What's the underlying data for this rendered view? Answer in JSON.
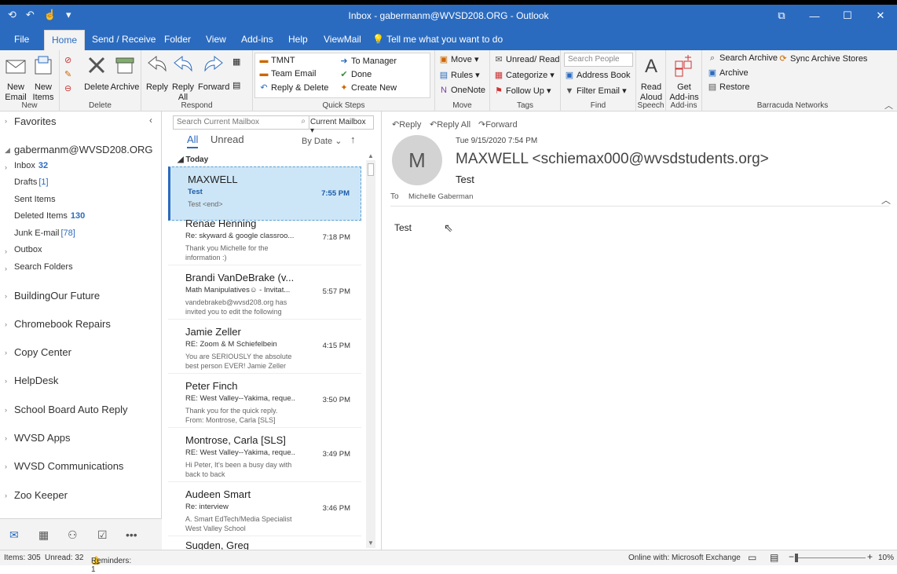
{
  "window": {
    "title": "Inbox - gabermanm@WVSD208.ORG  -  Outlook",
    "qat_icons": [
      "send-receive-icon",
      "undo-icon",
      "touch-mode-icon",
      "customize-icon"
    ],
    "controls": [
      "restore-icon",
      "minimize-icon",
      "maximize-icon",
      "close-icon"
    ]
  },
  "ribbon_tabs": [
    "File",
    "Home",
    "Send / Receive",
    "Folder",
    "View",
    "Add-ins",
    "Help",
    "ViewMail"
  ],
  "tell_me": "Tell me what you want to do",
  "ribbon": {
    "new_email": "New Email",
    "new_items": "New Items",
    "group_new": "New",
    "delete": "Delete",
    "archive": "Archive",
    "group_delete": "Delete",
    "reply": "Reply",
    "reply_all": "Reply All",
    "forward": "Forward",
    "group_respond": "Respond",
    "quick_steps": [
      "TMNT",
      "Team Email",
      "Reply & Delete",
      "To Manager",
      "Done",
      "Create New"
    ],
    "group_quick_steps": "Quick Steps",
    "move": "Move",
    "rules": "Rules",
    "onenote": "OneNote",
    "group_move": "Move",
    "unread_read": "Unread/ Read",
    "categorize": "Categorize",
    "follow_up": "Follow Up",
    "group_tags": "Tags",
    "search_people": "Search People",
    "address_book": "Address Book",
    "filter_email": "Filter Email",
    "group_find": "Find",
    "read_aloud": "Read Aloud",
    "group_speech": "Speech",
    "get_addins": "Get Add-ins",
    "group_addins": "Add-ins",
    "search_archive": "Search Archive",
    "sync_archive": "Sync Archive Stores",
    "archive2": "Archive",
    "restore": "Restore",
    "group_barracuda": "Barracuda Networks"
  },
  "nav": {
    "favorites": "Favorites",
    "account": "gabermanm@WVSD208.ORG",
    "inbox": "Inbox",
    "inbox_count": "32",
    "drafts": "Drafts",
    "drafts_count": "[1]",
    "sent": "Sent Items",
    "deleted": "Deleted Items",
    "deleted_count": "130",
    "junk": "Junk E-mail",
    "junk_count": "[78]",
    "outbox": "Outbox",
    "search_folders": "Search Folders",
    "folders": [
      "BuildingOur Future",
      "Chromebook Repairs",
      "Copy Center",
      "HelpDesk",
      "School Board Auto Reply",
      "WVSD Apps",
      "WVSD Communications",
      "Zoo Keeper"
    ],
    "bottom_icons": [
      "mail-icon",
      "calendar-icon",
      "people-icon",
      "tasks-icon",
      "more-icon"
    ]
  },
  "list": {
    "search_placeholder": "Search Current Mailbox",
    "scope": "Current Mailbox",
    "filter_all": "All",
    "filter_unread": "Unread",
    "sort": "By Date",
    "group_today": "Today",
    "messages": [
      {
        "from": "MAXWELL",
        "subject": "Test",
        "time": "7:55 PM",
        "preview": "Test <end>"
      },
      {
        "from": "Renae Henning",
        "subject": "Re: skyward & google classroo...",
        "time": "7:18 PM",
        "preview": "Thank you Michelle for the information :)"
      },
      {
        "from": "Brandi VanDeBrake (v...",
        "subject": "Math Manipulatives☺ - Invitat...",
        "time": "5:57 PM",
        "preview": "vandebrakeb@wvsd208.org has invited you to edit the following"
      },
      {
        "from": "Jamie Zeller",
        "subject": "RE: Zoom & M Schiefelbein",
        "time": "4:15 PM",
        "preview": "You are SERIOUSLY the absolute best person EVER!  Jamie Zeller"
      },
      {
        "from": "Peter Finch",
        "subject": "RE: West Valley--Yakima, reque...",
        "time": "3:50 PM",
        "preview": "Thank you for the quick reply. From: Montrose, Carla [SLS]"
      },
      {
        "from": "Montrose, Carla [SLS]",
        "subject": "RE: West Valley--Yakima, reque...",
        "time": "3:49 PM",
        "preview": "Hi Peter,  It's been a busy day with back to back"
      },
      {
        "from": "Audeen Smart",
        "subject": "Re: interview",
        "time": "3:46 PM",
        "preview": "A. Smart  EdTech/Media Specialist  West Valley School"
      },
      {
        "from": "Sugden, Greg",
        "subject": "",
        "time": "",
        "preview": ""
      }
    ]
  },
  "reading": {
    "reply": "Reply",
    "reply_all": "Reply All",
    "forward": "Forward",
    "date": "Tue 9/15/2020 7:54 PM",
    "avatar_letter": "M",
    "sender": "MAXWELL <schiemax000@wvsdstudents.org>",
    "subject": "Test",
    "to_label": "To",
    "to": "Michelle Gaberman",
    "body": "Test"
  },
  "status": {
    "items": "Items: 305",
    "unread": "Unread: 32",
    "reminders": "Reminders: 1",
    "online": "Online with: Microsoft Exchange",
    "zoom": "10%"
  },
  "colors": {
    "accent": "#2b6bbf",
    "selected": "#cde6f7"
  }
}
